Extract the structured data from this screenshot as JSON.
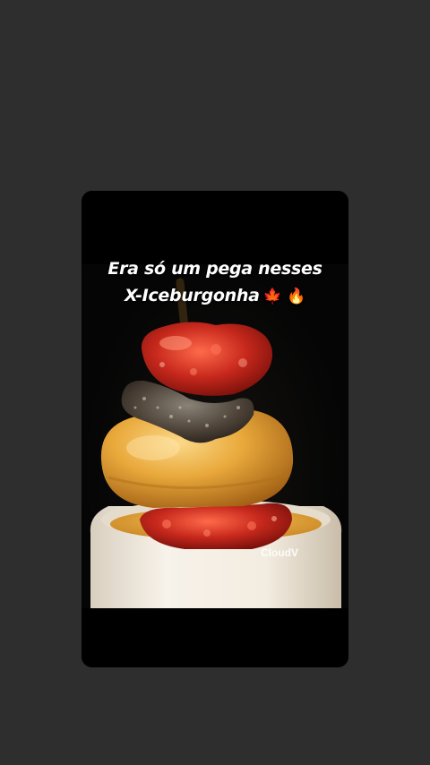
{
  "story": {
    "caption_line1": "Era só um pega nesses",
    "caption_line2": "X-Iceburgonha",
    "caption_emojis": "🍁 🔥",
    "watermark": "CloudV"
  },
  "colors": {
    "background": "#2e2e2f",
    "card": "#000000",
    "bun": "#e8a83a",
    "jam": "#c0261c",
    "cup": "#f3ece0"
  }
}
